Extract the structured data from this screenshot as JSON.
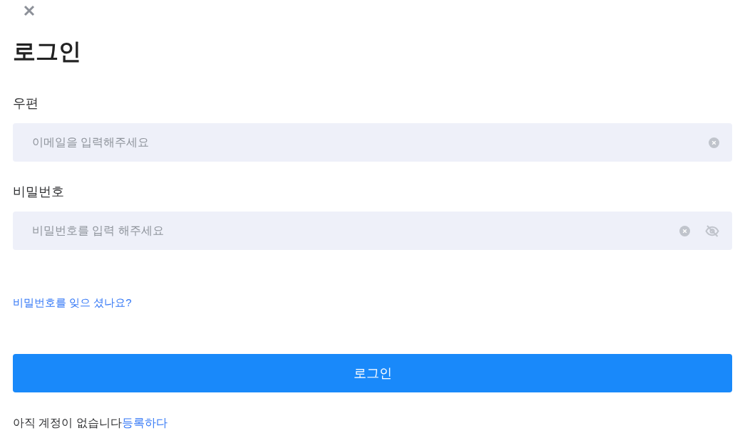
{
  "title": "로그인",
  "fields": [
    {
      "kind": "text",
      "label": "우편",
      "placeholder": "이메일을 입력해주세요"
    },
    {
      "kind": "password",
      "label": "비밀번호",
      "placeholder": "비밀번호를 입력 해주세요"
    }
  ],
  "forgot_link": "비밀번호를 잊으 셨나요?",
  "submit_button": "로그인",
  "signup_prompt": {
    "text": "아직 계정이 없습니다",
    "link": "등록하다"
  }
}
